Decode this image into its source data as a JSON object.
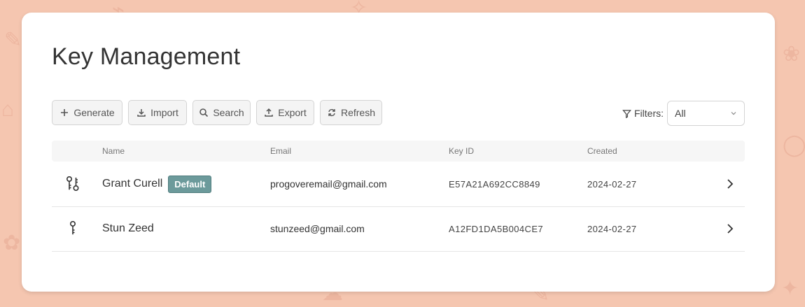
{
  "page": {
    "title": "Key Management"
  },
  "toolbar": {
    "generate": "Generate",
    "import": "Import",
    "search": "Search",
    "export": "Export",
    "refresh": "Refresh"
  },
  "filters": {
    "label": "Filters:",
    "selected": "All"
  },
  "table": {
    "columns": [
      "Name",
      "Email",
      "Key ID",
      "Created"
    ],
    "rows": [
      {
        "name": "Grant Curell",
        "badge": "Default",
        "email": "progoveremail@gmail.com",
        "key_id": "E57A21A692CC8849",
        "created": "2024-02-27",
        "icon": "keypair-icon"
      },
      {
        "name": "Stun Zeed",
        "badge": "",
        "email": "stunzeed@gmail.com",
        "key_id": "A12FD1DA5B004CE7",
        "created": "2024-02-27",
        "icon": "key-icon"
      }
    ]
  },
  "colors": {
    "background": "#f5c6b0",
    "badge": "#6c9a9b",
    "card": "#ffffff"
  }
}
